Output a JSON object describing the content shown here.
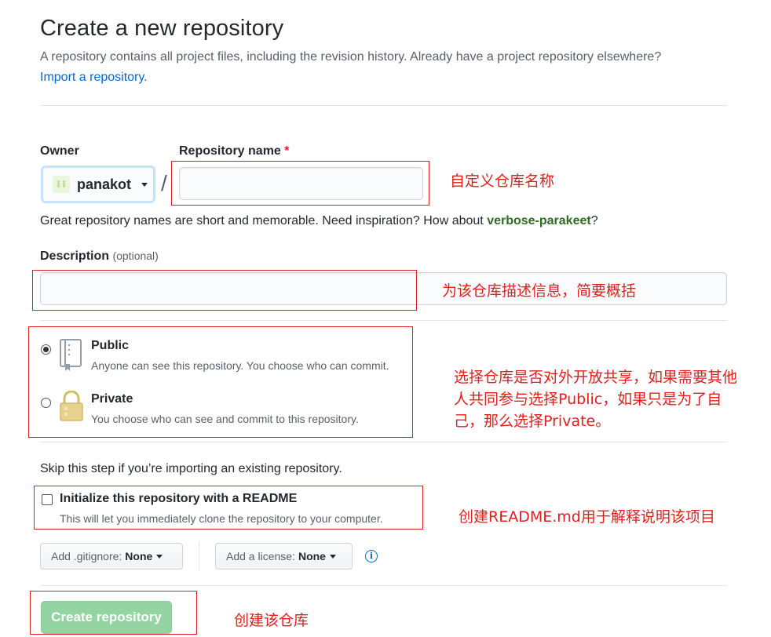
{
  "header": {
    "title": "Create a new repository",
    "subtitle": "A repository contains all project files, including the revision history. Already have a project repository elsewhere?",
    "import_link": "Import a repository."
  },
  "owner": {
    "label": "Owner",
    "value": "panakot"
  },
  "repo_name": {
    "label": "Repository name",
    "required_mark": "*",
    "value": "",
    "separator": "/"
  },
  "hint": {
    "text": "Great repository names are short and memorable. Need inspiration? How about ",
    "suggestion": "verbose-parakeet",
    "end": "?"
  },
  "description": {
    "label": "Description",
    "optional": "(optional)",
    "value": ""
  },
  "visibility": {
    "selected": "public",
    "options": [
      {
        "title": "Public",
        "desc": "Anyone can see this repository. You choose who can commit.",
        "icon": "repo-book-icon"
      },
      {
        "title": "Private",
        "desc": "You choose who can see and commit to this repository.",
        "icon": "lock-icon"
      }
    ]
  },
  "init": {
    "skip_text": "Skip this step if you’re importing an existing repository.",
    "readme_label": "Initialize this repository with a README",
    "readme_desc": "This will let you immediately clone the repository to your computer.",
    "checked": false
  },
  "selects": {
    "gitignore_label": "Add .gitignore:",
    "gitignore_value": "None",
    "license_label": "Add a license:",
    "license_value": "None",
    "info_icon": "i"
  },
  "submit": {
    "label": "Create repository",
    "disabled": true
  },
  "annotations": {
    "name": "自定义仓库名称",
    "description": "为该仓库描述信息，简要概括",
    "visibility_line1": "选择仓库是否对外开放共享，如果需要其他",
    "visibility_line2": "人共同参与选择Public，如果只是为了自",
    "visibility_line3": "己，那么选择Private。",
    "readme": "创建README.md用于解释说明该项目",
    "create": "创建该仓库"
  },
  "colors": {
    "annotation_red": "#e0201f",
    "link_blue": "#0366d6",
    "create_button_disabled": "#94d3a2",
    "suggestion_green": "#2c6e1f"
  }
}
